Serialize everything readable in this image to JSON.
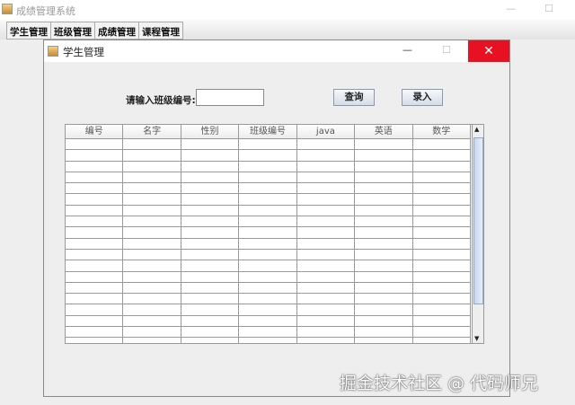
{
  "app": {
    "title": "成绩管理系统",
    "minimize": "—",
    "maximize": "☐"
  },
  "menu": {
    "tabs": [
      "学生管理",
      "班级管理",
      "成绩管理",
      "课程管理"
    ]
  },
  "dialog": {
    "title": "学生管理",
    "minimize": "—",
    "maximize": "☐",
    "close": "✕",
    "class_label": "请输入班级编号:",
    "class_input_value": "",
    "query_button": "查询",
    "add_button": "录入"
  },
  "table": {
    "columns": [
      "编号",
      "名字",
      "性别",
      "班级编号",
      "java",
      "英语",
      "数学"
    ],
    "rows": 19
  },
  "watermark": "掘金技术社区 @ 代码师兄"
}
